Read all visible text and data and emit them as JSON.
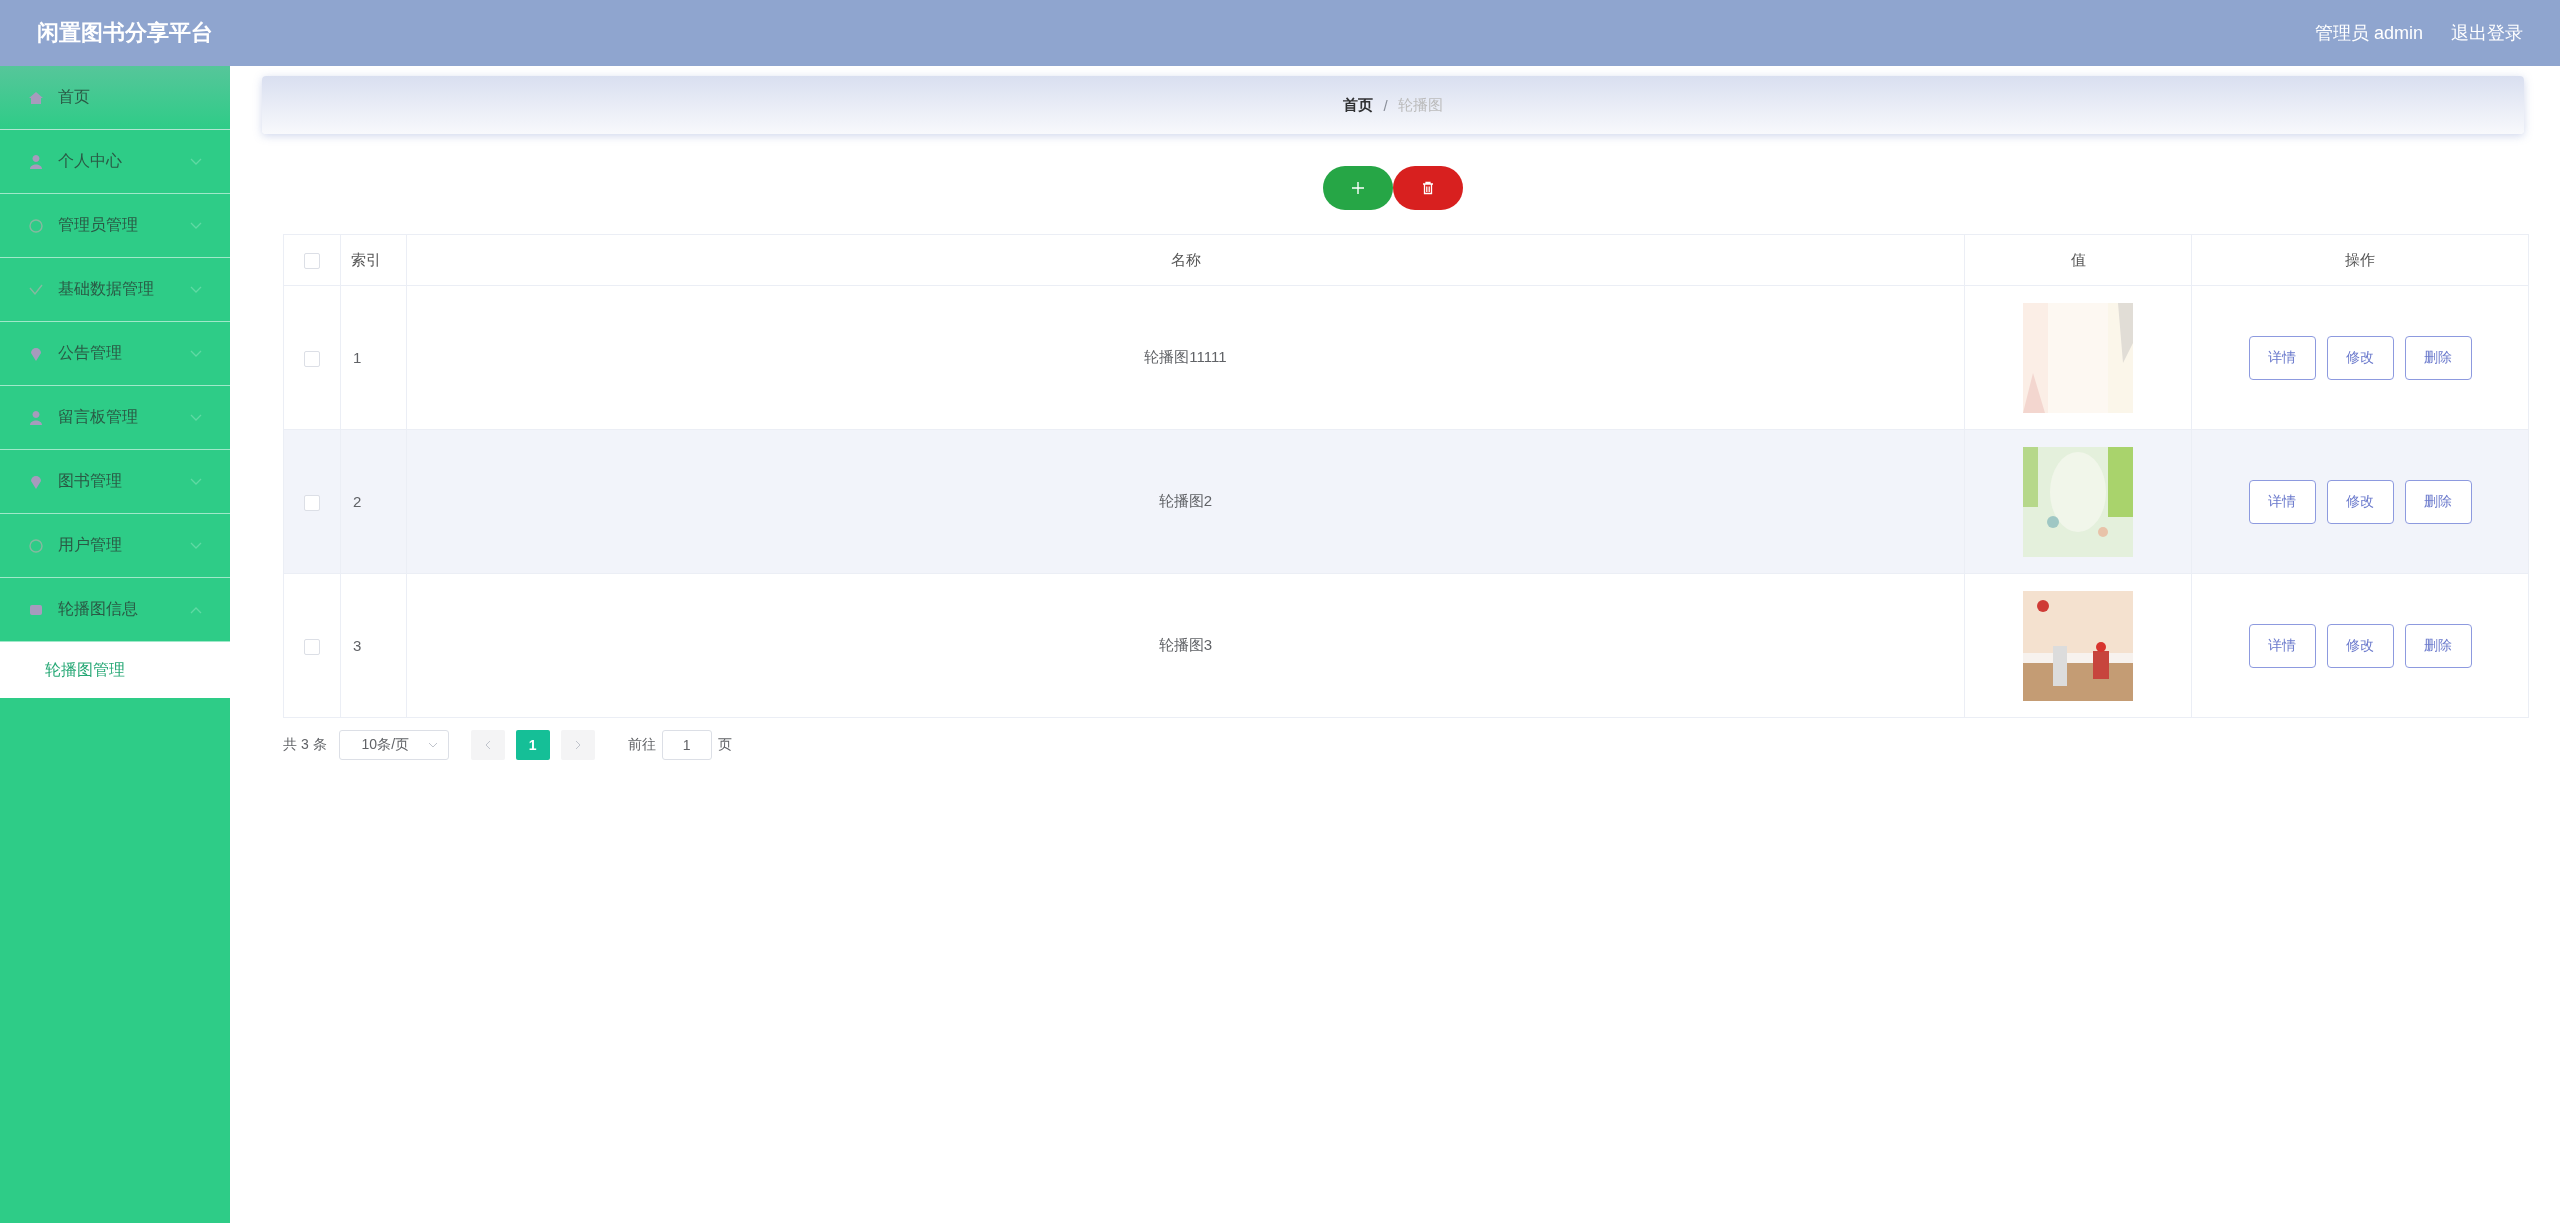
{
  "header": {
    "title": "闲置图书分享平台",
    "user": "管理员 admin",
    "logout": "退出登录"
  },
  "sidebar": {
    "items": [
      {
        "label": "首页",
        "kind": "link"
      },
      {
        "label": "个人中心",
        "kind": "group",
        "expanded": false
      },
      {
        "label": "管理员管理",
        "kind": "group",
        "expanded": false
      },
      {
        "label": "基础数据管理",
        "kind": "group",
        "expanded": false
      },
      {
        "label": "公告管理",
        "kind": "group",
        "expanded": false
      },
      {
        "label": "留言板管理",
        "kind": "group",
        "expanded": false
      },
      {
        "label": "图书管理",
        "kind": "group",
        "expanded": false
      },
      {
        "label": "用户管理",
        "kind": "group",
        "expanded": false
      },
      {
        "label": "轮播图信息",
        "kind": "group",
        "expanded": true,
        "children": [
          {
            "label": "轮播图管理",
            "selected": true
          }
        ]
      }
    ]
  },
  "breadcrumb": [
    "首页",
    "轮播图"
  ],
  "breadcrumb_separator": "/",
  "table": {
    "columns": [
      "索引",
      "名称",
      "值",
      "操作"
    ],
    "all_checked": false,
    "rows": [
      {
        "index": "1",
        "name": "轮播图11111",
        "checked": false,
        "hover": false,
        "actions": [
          "详情",
          "修改",
          "删除"
        ]
      },
      {
        "index": "2",
        "name": "轮播图2",
        "checked": false,
        "hover": true,
        "actions": [
          "详情",
          "修改",
          "删除"
        ]
      },
      {
        "index": "3",
        "name": "轮播图3",
        "checked": false,
        "hover": false,
        "actions": [
          "详情",
          "修改",
          "删除"
        ]
      }
    ]
  },
  "pagination": {
    "total": "共 3 条",
    "page_size": "10条/页",
    "pages": [
      {
        "label": "1",
        "selected": true
      }
    ],
    "goto": "前往",
    "goto_value": "1",
    "goto_unit": "页"
  }
}
